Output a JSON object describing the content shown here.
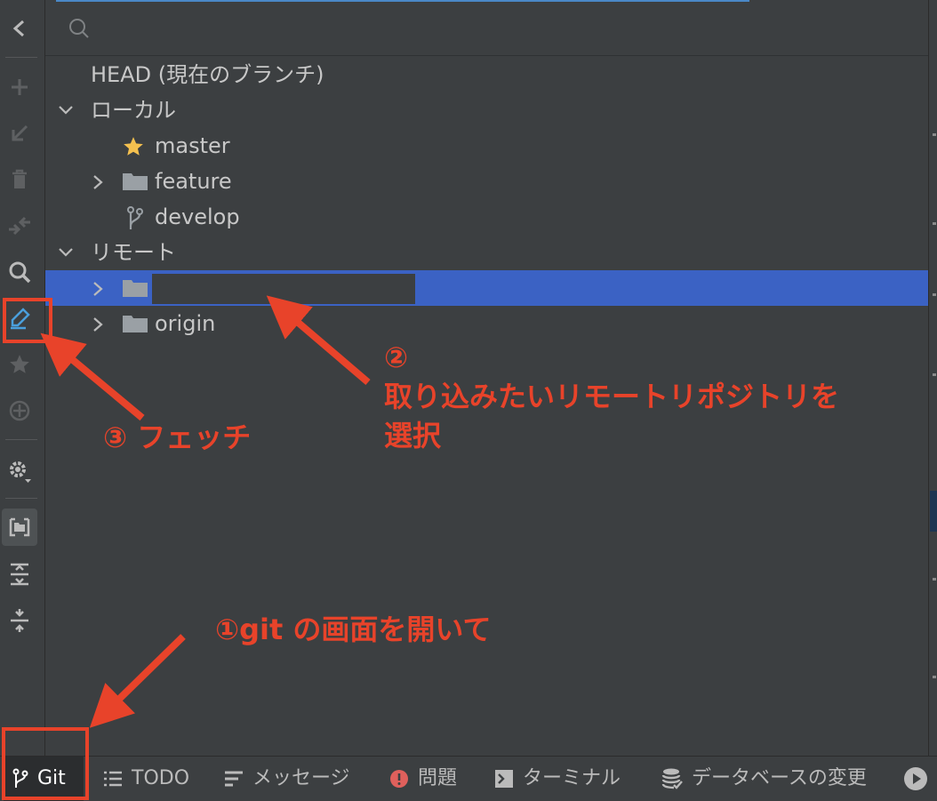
{
  "search": {
    "placeholder": ""
  },
  "tree": {
    "head_label": "HEAD (現在のブランチ)",
    "local_label": "ローカル",
    "local_items": [
      {
        "label": "master",
        "icon": "star-icon"
      },
      {
        "label": "feature",
        "icon": "folder-icon"
      },
      {
        "label": "develop",
        "icon": "branch-icon"
      }
    ],
    "remote_label": "リモート",
    "remote_items": [
      {
        "label": "",
        "icon": "folder-icon",
        "selected": true,
        "redacted": true
      },
      {
        "label": "origin",
        "icon": "folder-icon"
      }
    ]
  },
  "bottom_tabs": [
    {
      "label": "Git",
      "icon": "git-branch-icon",
      "active": true
    },
    {
      "label": "TODO",
      "icon": "list-icon"
    },
    {
      "label": "メッセージ",
      "icon": "message-icon"
    },
    {
      "label": "問題",
      "icon": "problem-icon"
    },
    {
      "label": "ターミナル",
      "icon": "terminal-icon"
    },
    {
      "label": "データベースの変更",
      "icon": "database-icon"
    }
  ],
  "annotations": {
    "step1": "①git の画面を開いて",
    "step2_num": "②",
    "step2_line1": "取り込みたいリモートリポジトリを",
    "step2_line2": "選択",
    "step3": "③ フェッチ"
  },
  "colors": {
    "annotation": "#e8432a",
    "selection": "#3b62c4",
    "background": "#3c3f41",
    "star": "#f4c04f",
    "fetch_icon": "#4a9fdc"
  }
}
